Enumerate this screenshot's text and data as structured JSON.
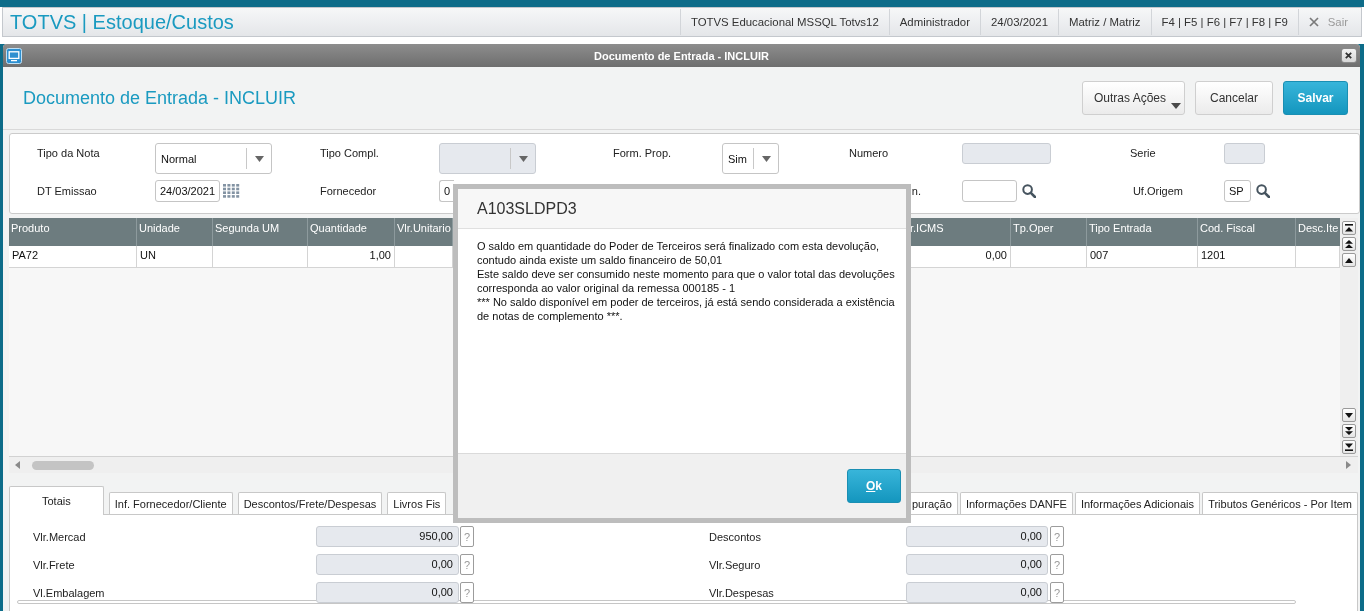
{
  "top_bar": {
    "app_title": "TOTVS | Estoque/Custos",
    "info": [
      "TOTVS Educacional MSSQL Totvs12",
      "Administrador",
      "24/03/2021",
      "Matriz / Matriz",
      "F4 | F5 | F6 | F7 | F8 | F9"
    ],
    "exit_button": "Sair"
  },
  "window": {
    "title": "Documento de Entrada - INCLUIR"
  },
  "page_header": {
    "heading": "Documento de Entrada - INCLUIR",
    "buttons": [
      {
        "label": "Outras Ações",
        "kind": "menu"
      },
      {
        "label": "Cancelar",
        "kind": "secondary"
      },
      {
        "label": "Salvar",
        "kind": "primary"
      }
    ]
  },
  "form": {
    "rows": [
      [
        {
          "label": "Tipo da Nota",
          "kind": "combo",
          "value": "Normal",
          "disabled": false
        },
        {
          "label": "Tipo Compl.",
          "kind": "combo",
          "disabled": true
        },
        {
          "label": "Form. Prop.",
          "kind": "combo",
          "value": "Sim",
          "disabled": false
        },
        {
          "label": "Numero",
          "kind": "text",
          "disabled": true
        },
        {
          "label": "Serie",
          "kind": "text",
          "disabled": true
        }
      ],
      [
        {
          "label": "DT Emissao",
          "kind": "date",
          "value": "24/03/2021",
          "disabled": false
        },
        {
          "label": "Fornecedor",
          "kind": "text",
          "value": "0",
          "disabled": false
        },
        "",
        {
          "label": "n.",
          "kind": "lookup",
          "disabled": false
        },
        {
          "label": "Uf.Origem",
          "kind": "lookup",
          "value": "SP",
          "disabled": false
        }
      ]
    ]
  },
  "items_table": {
    "columns": [
      {
        "label": "Produto",
        "kind": "text"
      },
      {
        "label": "Unidade",
        "kind": "text"
      },
      {
        "label": "Segunda UM",
        "kind": "text"
      },
      {
        "label": "Quantidade",
        "kind": "number"
      },
      {
        "label": "Vlr.Unitario",
        "kind": "number"
      },
      {
        "label": "r.ICMS",
        "kind": "number"
      },
      {
        "label": "Tp.Oper",
        "kind": "text"
      },
      {
        "label": "Tipo Entrada",
        "kind": "text"
      },
      {
        "label": "Cod. Fiscal",
        "kind": "text"
      },
      {
        "label": "Desc.Ite",
        "kind": "text"
      }
    ],
    "rows": [
      {
        "cells": [
          "PA72",
          "UN",
          null,
          "1,00",
          null,
          "0,00",
          null,
          "007",
          "1201",
          null
        ]
      }
    ]
  },
  "tabs": [
    {
      "label": "Totais",
      "selected": true
    },
    {
      "label": "Inf. Fornecedor/Cliente",
      "selected": false
    },
    {
      "label": "Descontos/Frete/Despesas",
      "selected": false
    },
    {
      "label": "Livros Fis",
      "selected": false
    },
    {
      "label": "puração",
      "selected": false
    },
    {
      "label": "Informações DANFE",
      "selected": false
    },
    {
      "label": "Informações Adicionais",
      "selected": false
    },
    {
      "label": "Tributos Genéricos - Por Item",
      "selected": false
    }
  ],
  "totals": [
    {
      "label": "Vlr.Mercad",
      "value": "950,00",
      "help": "?",
      "disabled": true
    },
    {
      "label": "Descontos",
      "value": "0,00",
      "help": "?",
      "disabled": true
    },
    {
      "label": "Vlr.Frete",
      "value": "0,00",
      "help": "?",
      "disabled": true
    },
    {
      "label": "Vlr.Seguro",
      "value": "0,00",
      "help": "?",
      "disabled": true
    },
    {
      "label": "Vl.Embalagem",
      "value": "0,00",
      "help": "?",
      "disabled": true
    },
    {
      "label": "Vlr.Despesas",
      "value": "0,00",
      "help": "?",
      "disabled": true
    }
  ],
  "dialog": {
    "title": "A103SLDPD3",
    "message": "O saldo em quantidade do Poder de Terceiros será finalizado com esta devolução,\ncontudo ainda existe um saldo financeiro de 50,01\nEste saldo deve ser consumido neste momento para que o valor total das devoluções\ncorresponda ao valor original da remessa 000185 - 1\n*** No saldo disponível em poder de terceiros, já está sendo considerada a existência\nde notas de complemento ***.",
    "button": "Ok"
  }
}
